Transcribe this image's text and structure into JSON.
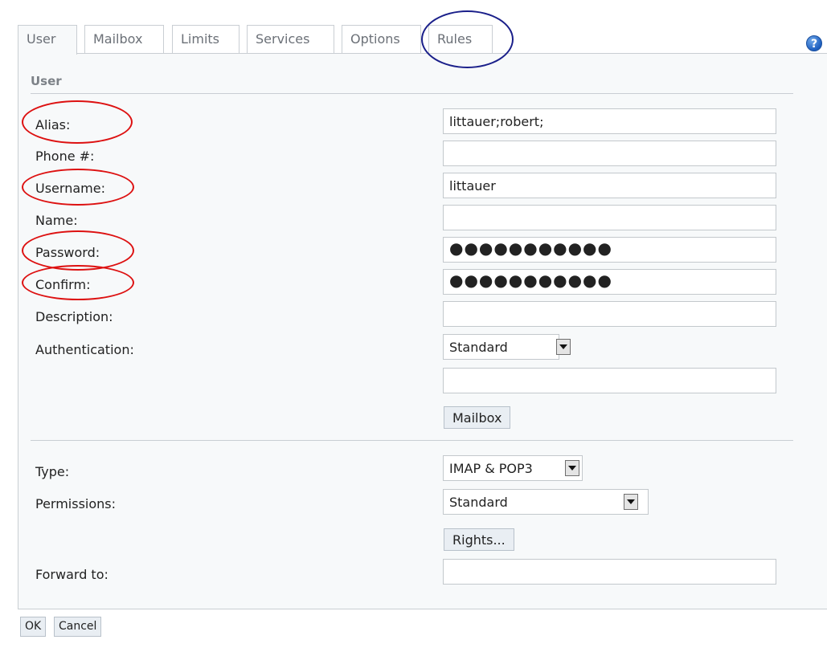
{
  "tabs": [
    {
      "label": "User",
      "active": true
    },
    {
      "label": "Mailbox",
      "active": false
    },
    {
      "label": "Limits",
      "active": false
    },
    {
      "label": "Services",
      "active": false
    },
    {
      "label": "Options",
      "active": false
    },
    {
      "label": "Rules",
      "active": false
    }
  ],
  "help_icon": {
    "icon": "question-mark-icon",
    "glyph": "?"
  },
  "section": {
    "title": "User"
  },
  "form": {
    "alias": {
      "label": "Alias:",
      "value": "littauer;robert;"
    },
    "phone": {
      "label": "Phone #:",
      "value": ""
    },
    "username": {
      "label": "Username:",
      "value": "littauer"
    },
    "name": {
      "label": "Name:",
      "value": ""
    },
    "password": {
      "label": "Password:",
      "value": "●●●●●●●●●●●"
    },
    "confirm": {
      "label": "Confirm:",
      "value": "●●●●●●●●●●●"
    },
    "description": {
      "label": "Description:",
      "value": ""
    },
    "authentication": {
      "label": "Authentication:",
      "selected": "Standard",
      "extra_value": ""
    },
    "mailbox_button": "Mailbox",
    "type": {
      "label": "Type:",
      "selected": "IMAP & POP3"
    },
    "permissions": {
      "label": "Permissions:",
      "selected": "Standard"
    },
    "rights_button": "Rights...",
    "forward_to": {
      "label": "Forward to:",
      "value": ""
    }
  },
  "footer": {
    "ok": "OK",
    "cancel": "Cancel"
  },
  "annotation_colors": {
    "highlight_red": "#dd1111",
    "highlight_blue": "#1a1f8a"
  }
}
